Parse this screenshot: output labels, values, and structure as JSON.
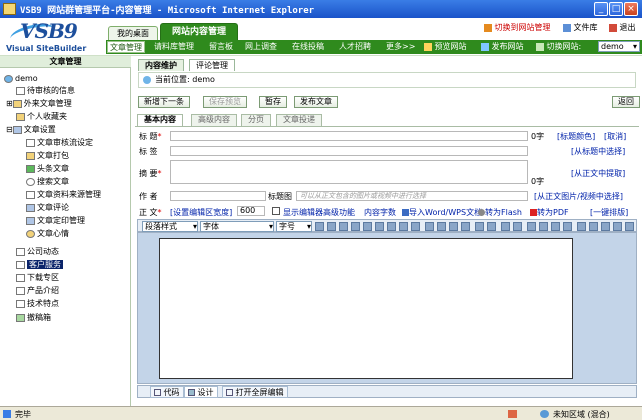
{
  "window": {
    "title": "VSB9 网站群管理平台-内容管理 - Microsoft Internet Explorer"
  },
  "logo": {
    "text": "VSB9",
    "subtitle": "Visual SiteBuilder"
  },
  "header": {
    "tab_home": "我的桌面",
    "tab_active": "网站内容管理",
    "link_switch_admin": "切换到网站管理",
    "link_library": "文件库",
    "link_exit": "退出"
  },
  "menubar": {
    "items": [
      "文章管理",
      "请料库管理",
      "留言板",
      "网上调查",
      "在线投稿",
      "人才招聘",
      "更多>>"
    ],
    "preview": "预览网站",
    "publish": "发布网站",
    "switch_label": "切换网站:",
    "site_value": "demo"
  },
  "sidebar": {
    "heading": "文章管理",
    "items": [
      {
        "label": "demo"
      },
      {
        "label": "待审核的信息"
      },
      {
        "label": "外来文章管理"
      },
      {
        "label": "个人收藏夹"
      },
      {
        "label": "文章设置"
      },
      {
        "label": "文章审核流设定"
      },
      {
        "label": "文章打包"
      },
      {
        "label": "头条文章"
      },
      {
        "label": "搜索文章"
      },
      {
        "label": "文章资料来源管理"
      },
      {
        "label": "文章评论"
      },
      {
        "label": "文章定印管理"
      },
      {
        "label": "文章心情"
      },
      {
        "label": "公司动态"
      },
      {
        "label": "客户服务"
      },
      {
        "label": "下载专区"
      },
      {
        "label": "产品介绍"
      },
      {
        "label": "技术特点"
      },
      {
        "label": "撤稿箱"
      }
    ]
  },
  "main": {
    "subtabs": [
      "内容维护",
      "评论管理"
    ],
    "location_label": "当前位置:",
    "location_value": "demo",
    "actions": [
      "新增下一条",
      "保存预览",
      "暂存",
      "发布文章"
    ],
    "back": "返回",
    "form_tabs": [
      "基本内容",
      "高级内容",
      "分页",
      "文章投递"
    ]
  },
  "form": {
    "title_label": "标  题",
    "title_count": "0字",
    "title_color_link": "[标题颜色]",
    "cancel_link": "[取消]",
    "tag_label": "标  签",
    "tag_from_title_link": "[从标题中选择]",
    "summary_label": "摘  要",
    "summary_count": "0字",
    "summary_from_body_link": "[从正文中提取]",
    "author_label": "作  者",
    "title_image_label": "标题图",
    "title_image_placeholder": "可以从正文包含的图片或视频中进行选择",
    "title_image_link": "[从正文图片/视频中选择]",
    "body_label": "正  文",
    "editor_width_link": "[设置编辑区宽度]",
    "editor_width_value": "600",
    "show_advanced": "显示编辑器高级功能",
    "word_count": "内容字数",
    "import_word": "导入Word/WPS文档",
    "to_flash": "转为Flash",
    "to_pdf": "转为PDF",
    "layout_link": "[一键排版]"
  },
  "editor": {
    "style_select": "段落样式",
    "font_select": "字体",
    "size_select": "字号",
    "modes": [
      "代码",
      "设计",
      "打开全屏编辑"
    ]
  },
  "status": {
    "left": "完毕",
    "zone": "未知区域 (混合)"
  },
  "colors": {
    "brand_green": "#2f8a1d",
    "title_blue": "#1a53c9",
    "link_blue": "#0022aa"
  }
}
